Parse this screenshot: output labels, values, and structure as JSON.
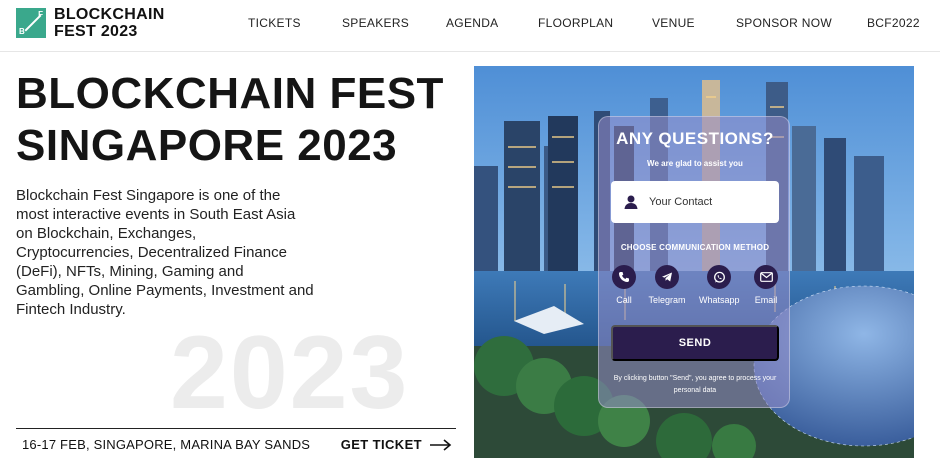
{
  "brand": {
    "logo_letters": [
      "B",
      "F"
    ],
    "line1": "BLOCKCHAIN",
    "line2": "FEST 2023"
  },
  "nav": [
    "TICKETS",
    "SPEAKERS",
    "AGENDA",
    "FLOORPLAN",
    "VENUE",
    "SPONSOR NOW",
    "BCF2022"
  ],
  "hero": {
    "title_line1": "BLOCKCHAIN FEST",
    "title_line2": "SINGAPORE 2023",
    "description": "Blockchain Fest Singapore is one of the most interactive events in South East Asia on Blockchain, Exchanges, Cryptocurrencies, Decentralized Finance (DeFi), NFTs, Mining, Gaming and Gambling, Online Payments, Investment and Fintech Industry.",
    "bg_year": "2023"
  },
  "ticket_bar": {
    "info": "16-17 FEB, SINGAPORE, MARINA BAY SANDS",
    "cta": "GET TICKET"
  },
  "contact_card": {
    "title": "ANY QUESTIONS?",
    "subtitle": "We are glad to assist you",
    "input_placeholder": "Your Contact",
    "method_label": "CHOOSE COMMUNICATION METHOD",
    "methods": [
      {
        "label": "Call",
        "icon": "phone-icon"
      },
      {
        "label": "Telegram",
        "icon": "telegram-icon"
      },
      {
        "label": "Whatsapp",
        "icon": "whatsapp-icon"
      },
      {
        "label": "Email",
        "icon": "email-icon"
      }
    ],
    "send_label": "SEND",
    "disclaimer": "By clicking button \"Send\", you agree to process your personal data"
  },
  "colors": {
    "brand_green": "#3aa88c",
    "dark_purple": "#2b1d4d",
    "text": "#151515"
  }
}
